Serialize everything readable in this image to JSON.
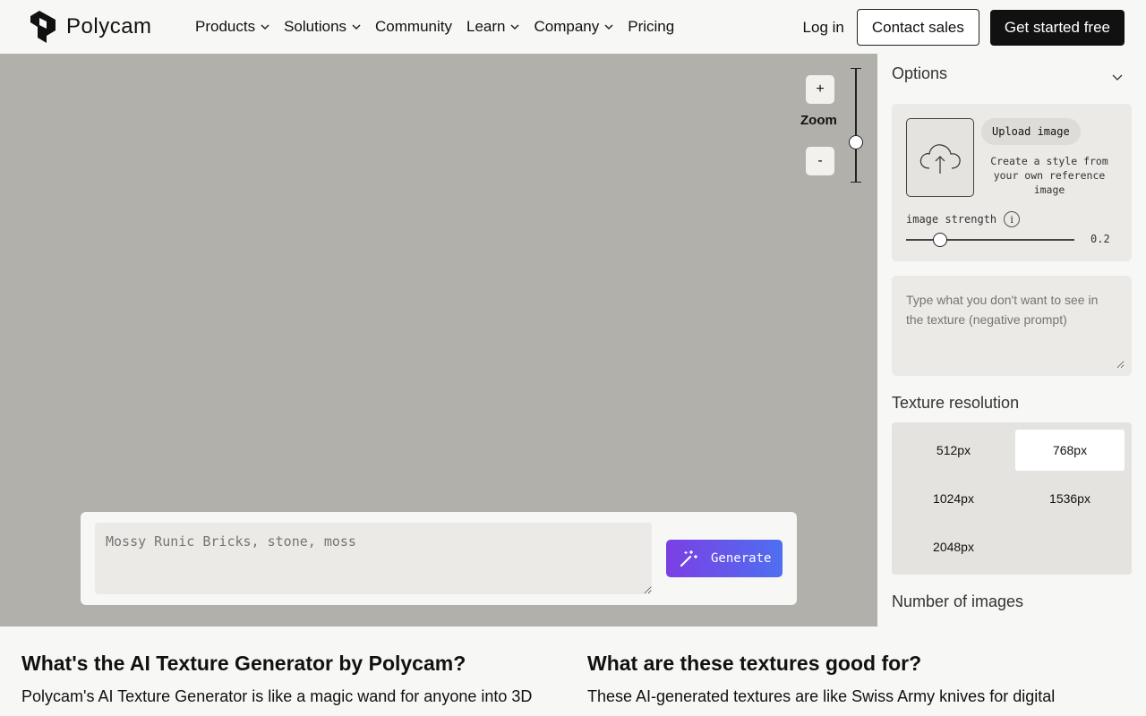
{
  "header": {
    "logo_text": "Polycam",
    "nav": [
      {
        "label": "Products",
        "dropdown": true
      },
      {
        "label": "Solutions",
        "dropdown": true
      },
      {
        "label": "Community",
        "dropdown": false
      },
      {
        "label": "Learn",
        "dropdown": true
      },
      {
        "label": "Company",
        "dropdown": true
      },
      {
        "label": "Pricing",
        "dropdown": false
      }
    ],
    "login": "Log in",
    "contact": "Contact sales",
    "cta": "Get started free"
  },
  "canvas": {
    "zoom_plus": "+",
    "zoom_label": "Zoom",
    "zoom_minus": "-",
    "prompt_placeholder": "Mossy Runic Bricks, stone, moss",
    "generate_label": "Generate"
  },
  "panel": {
    "options_title": "Options",
    "upload_label": "Upload image",
    "upload_desc": "Create a style from your own reference image",
    "strength_label": "image strength",
    "strength_value": "0.2",
    "strength_fraction": 0.2,
    "negative_placeholder": "Type what you don't want to see in the texture (negative prompt)",
    "resolution_title": "Texture resolution",
    "resolutions": [
      {
        "label": "512px",
        "selected": false
      },
      {
        "label": "768px",
        "selected": true
      },
      {
        "label": "1024px",
        "selected": false
      },
      {
        "label": "1536px",
        "selected": false
      },
      {
        "label": "2048px",
        "selected": false
      }
    ],
    "num_images_title": "Number of images"
  },
  "content": {
    "col1_title": "What's the AI Texture Generator by Polycam?",
    "col1_text": "Polycam's AI Texture Generator is like a magic wand for anyone into 3D",
    "col2_title": "What are these textures good for?",
    "col2_text": "These AI-generated textures are like Swiss Army knives for digital"
  },
  "colors": {
    "canvas_bg": "#b1b0ab",
    "generate_gradient_start": "#7b3fe4",
    "generate_gradient_end": "#4f6ff0"
  }
}
